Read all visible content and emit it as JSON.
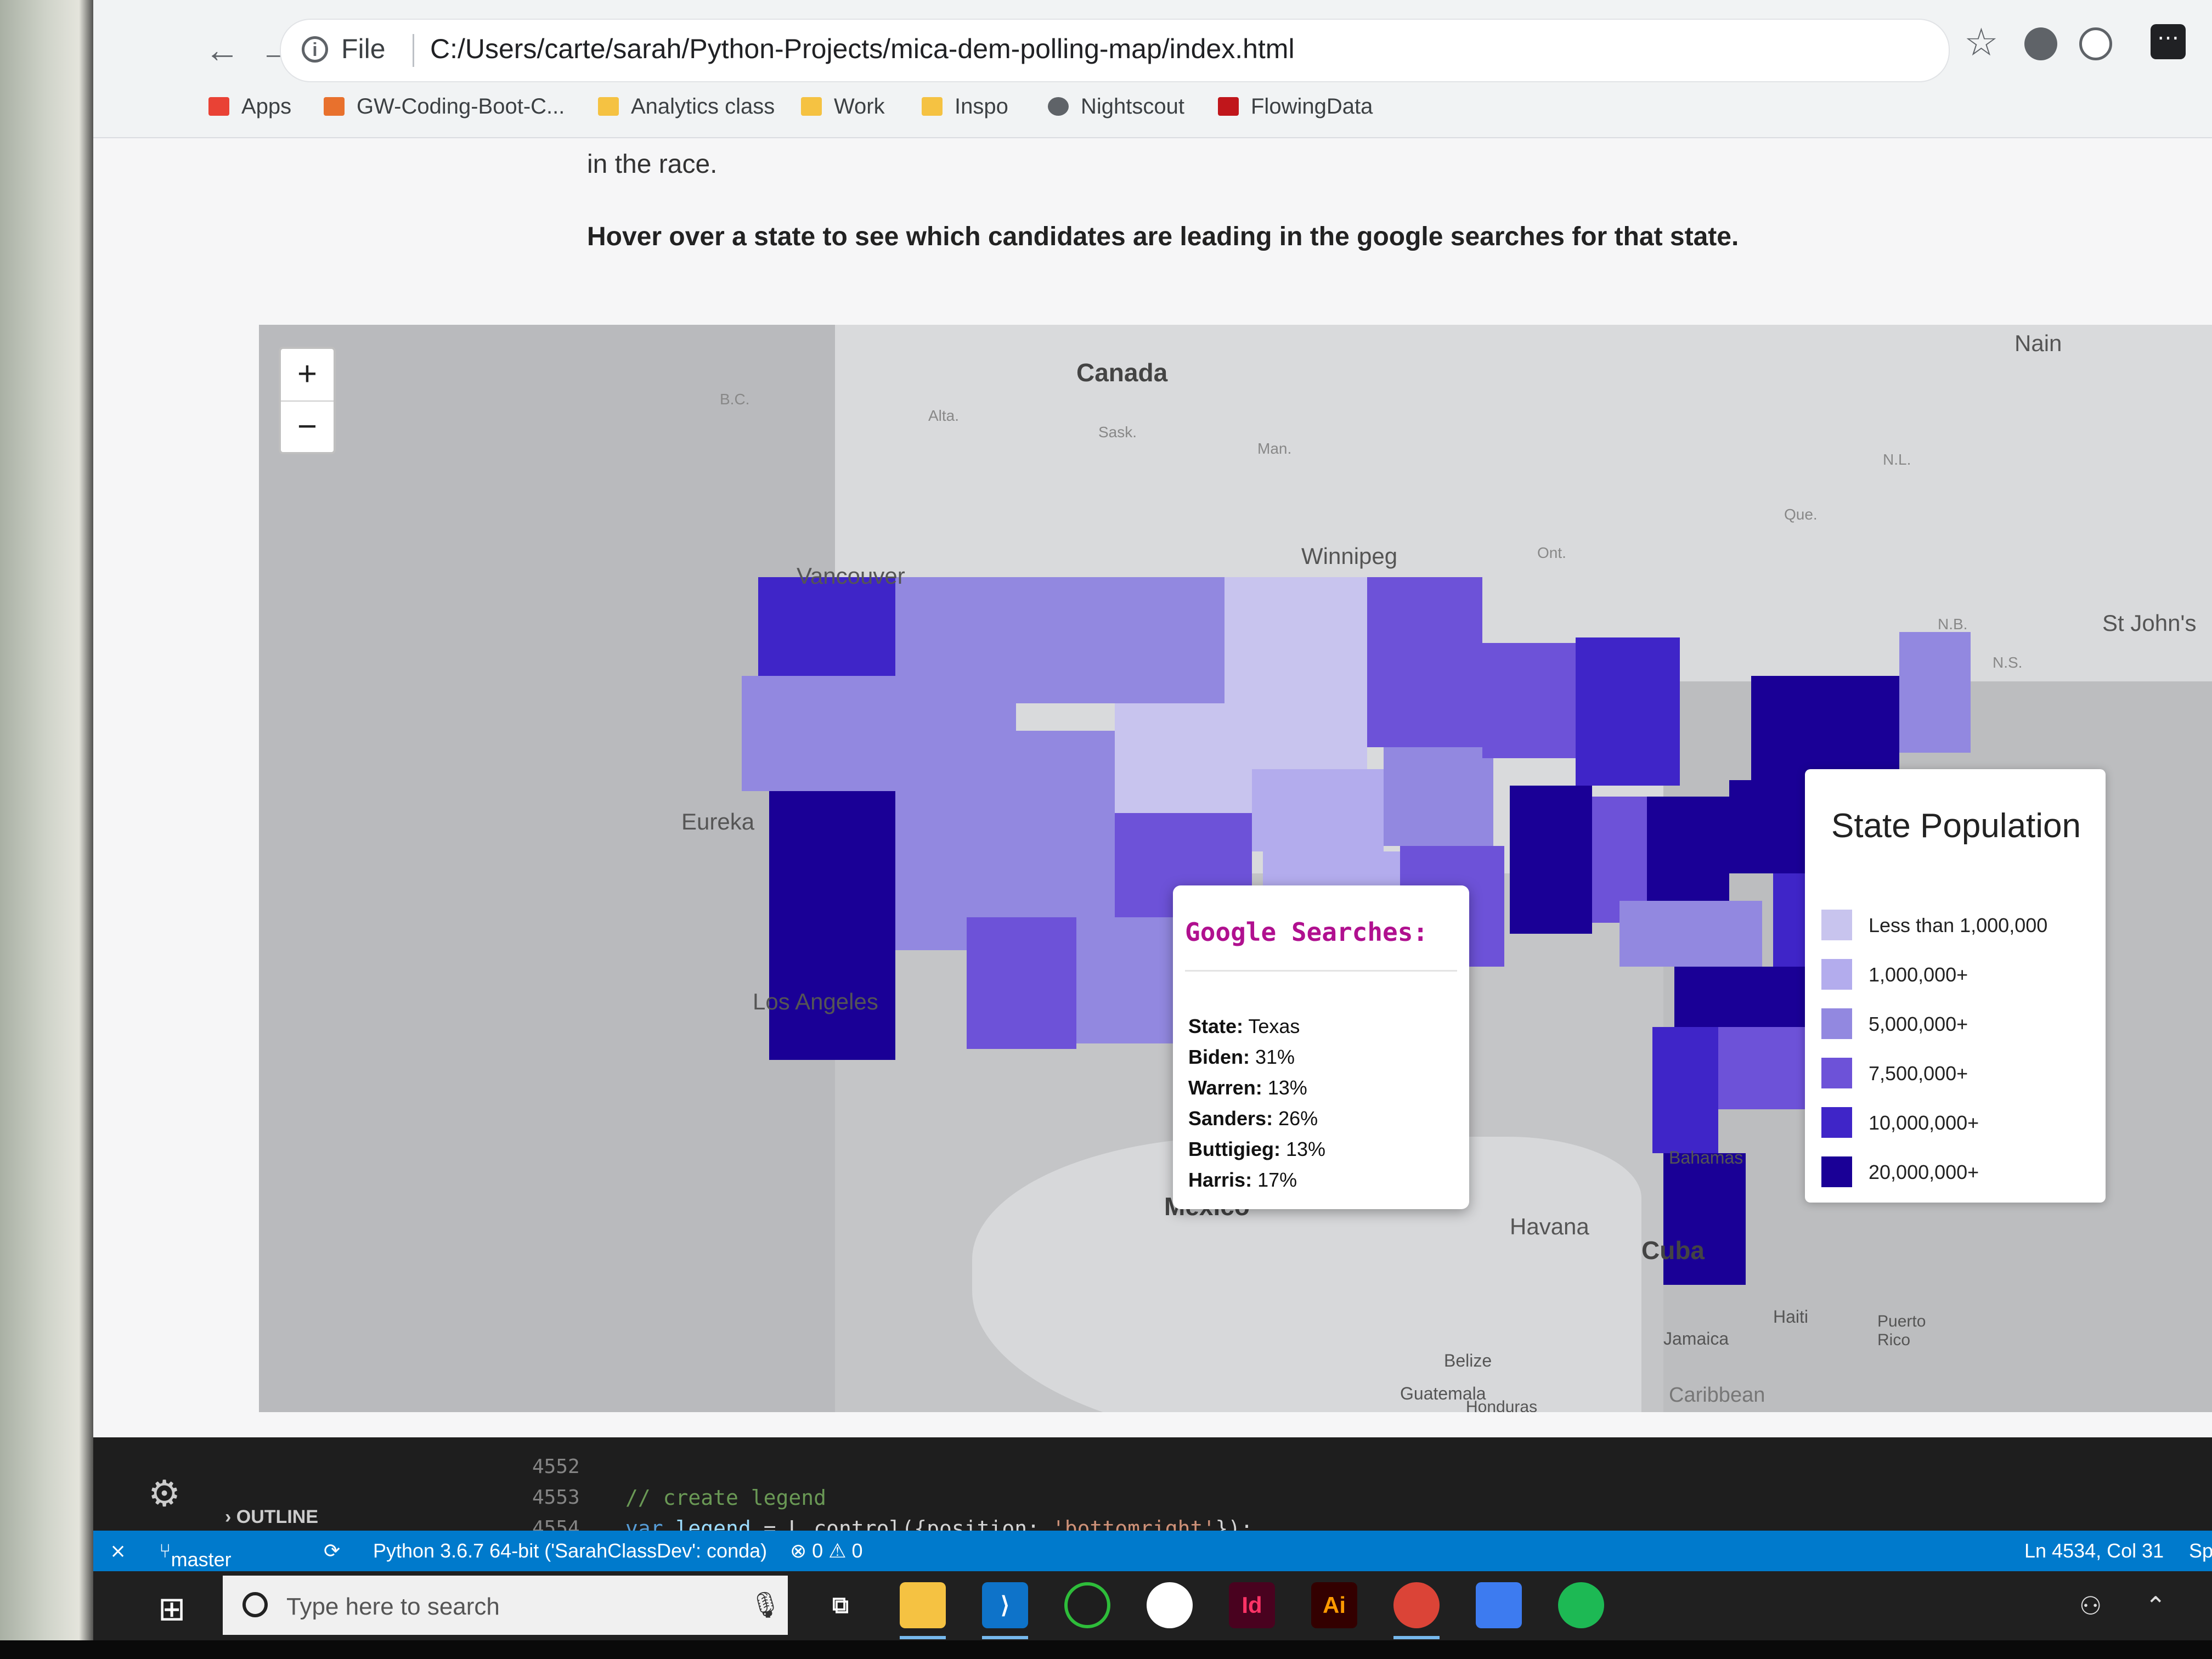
{
  "browser": {
    "address": {
      "scheme_label": "File",
      "url": "C:/Users/carte/sarah/Python-Projects/mica-dem-polling-map/index.html"
    },
    "bookmarks": [
      {
        "label": "Apps",
        "color": "#e94235"
      },
      {
        "label": "GW-Coding-Boot-C...",
        "color": "#e8712d"
      },
      {
        "label": "Analytics class",
        "color": "#f5c242"
      },
      {
        "label": "Work",
        "color": "#f5c242"
      },
      {
        "label": "Inspo",
        "color": "#f5c242"
      },
      {
        "label": "Nightscout",
        "color": "#5f6368"
      },
      {
        "label": "FlowingData",
        "color": "#c0161b"
      }
    ]
  },
  "page": {
    "intro_tail": "in the race.",
    "instruction": "Hover over a state to see which candidates are leading in the google searches for that state."
  },
  "map": {
    "labels": {
      "canada": "Canada",
      "winnipeg": "Winnipeg",
      "vancouver": "Vancouver",
      "eureka": "Eureka",
      "los_angeles": "Los Angeles",
      "mexico": "Mexico",
      "havana": "Havana",
      "cuba": "Cuba",
      "bahamas": "Bahamas",
      "jamaica": "Jamaica",
      "haiti": "Haiti",
      "puerto_rico": "Puerto Rico",
      "belize": "Belize",
      "guatemala": "Guatemala",
      "honduras": "Honduras",
      "caribbean": "Caribbean",
      "nain": "Nain",
      "st_johns": "St John's",
      "bc": "B.C.",
      "alta": "Alta.",
      "sask": "Sask.",
      "man": "Man.",
      "ont": "Ont.",
      "que": "Que.",
      "nl": "N.L.",
      "nb": "N.B.",
      "ns": "N.S."
    },
    "zoom": {
      "in": "+",
      "out": "−"
    },
    "popup": {
      "title": "Google Searches:",
      "state_label": "State:",
      "state_value": "Texas",
      "biden_label": "Biden:",
      "biden_value": "31%",
      "warren_label": "Warren:",
      "warren_value": "13%",
      "sanders_label": "Sanders:",
      "sanders_value": "26%",
      "buttigieg_label": "Buttigieg:",
      "buttigieg_value": "13%",
      "harris_label": "Harris:",
      "harris_value": "17%"
    },
    "legend": {
      "title": "State Population",
      "items": [
        {
          "label": "Less than 1,000,000",
          "color": "#c8c4ee"
        },
        {
          "label": "1,000,000+",
          "color": "#b3aced"
        },
        {
          "label": "5,000,000+",
          "color": "#9288e0"
        },
        {
          "label": "7,500,000+",
          "color": "#6d52d8"
        },
        {
          "label": "10,000,000+",
          "color": "#3f25c8"
        },
        {
          "label": "20,000,000+",
          "color": "#1a0096"
        }
      ]
    }
  },
  "vscode": {
    "outline": "OUTLINE",
    "line_numbers": [
      "4552",
      "4553",
      "4554"
    ],
    "comment": "// create legend",
    "code_kw": "var",
    "code_id": "legend",
    "code_mid": " = L.control({position: ",
    "code_str": "'bottomright'",
    "code_end": "});",
    "status": {
      "branch": "master",
      "python": "Python 3.6.7 64-bit ('SarahClassDev': conda)",
      "problems": "⊗ 0 ⚠ 0",
      "position": "Ln 4534, Col 31",
      "spaces": "Sp"
    }
  },
  "taskbar": {
    "search_placeholder": "Type here to search"
  }
}
